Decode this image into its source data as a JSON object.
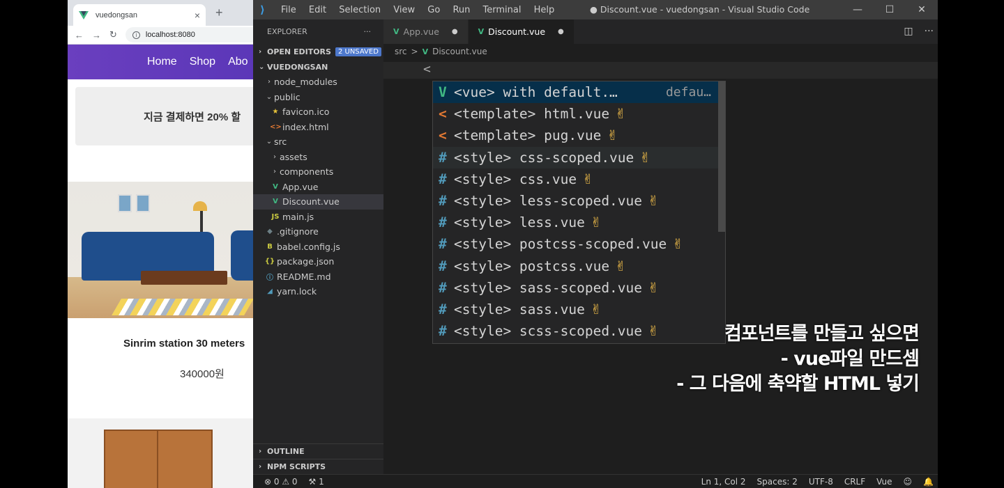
{
  "browser": {
    "tab_title": "vuedongsan",
    "tab_close": "×",
    "new_tab": "+",
    "address": "localhost:8080",
    "nav": [
      "Home",
      "Shop",
      "Abo"
    ],
    "banner_text": "지금 결제하면 20% 할",
    "product1_title": "Sinrim station 30 meters",
    "product1_price": "340000원",
    "colors": {
      "nav_bg": "#5b37b8"
    }
  },
  "vscode": {
    "logo": "vscode-logo-icon",
    "menu": [
      "File",
      "Edit",
      "Selection",
      "View",
      "Go",
      "Run",
      "Terminal",
      "Help"
    ],
    "window_title": "● Discount.vue - vuedongsan - Visual Studio Code",
    "window_controls": [
      "—",
      "☐",
      "✕"
    ],
    "explorer_title": "EXPLORER",
    "explorer_more": "···",
    "open_editors_label": "OPEN EDITORS",
    "open_editors_badge": "2 UNSAVED",
    "project_label": "VUEDONGSAN",
    "tree": [
      {
        "label": "node_modules",
        "indent": 1,
        "chev": "›",
        "icon": ""
      },
      {
        "label": "public",
        "indent": 1,
        "chev": "⌄",
        "icon": ""
      },
      {
        "label": "favicon.ico",
        "indent": 2,
        "chev": "",
        "icon": "★"
      },
      {
        "label": "index.html",
        "indent": 2,
        "chev": "",
        "icon": "<>"
      },
      {
        "label": "src",
        "indent": 1,
        "chev": "⌄",
        "icon": ""
      },
      {
        "label": "assets",
        "indent": 2,
        "chev": "›",
        "icon": ""
      },
      {
        "label": "components",
        "indent": 2,
        "chev": "›",
        "icon": ""
      },
      {
        "label": "App.vue",
        "indent": 2,
        "chev": "",
        "icon": "V"
      },
      {
        "label": "Discount.vue",
        "indent": 2,
        "chev": "",
        "icon": "V",
        "selected": true
      },
      {
        "label": "main.js",
        "indent": 2,
        "chev": "",
        "icon": "JS"
      },
      {
        "label": ".gitignore",
        "indent": 1,
        "chev": "",
        "icon": "◆"
      },
      {
        "label": "babel.config.js",
        "indent": 1,
        "chev": "",
        "icon": "B"
      },
      {
        "label": "package.json",
        "indent": 1,
        "chev": "",
        "icon": "{}"
      },
      {
        "label": "README.md",
        "indent": 1,
        "chev": "",
        "icon": "ⓘ"
      },
      {
        "label": "yarn.lock",
        "indent": 1,
        "chev": "",
        "icon": "◢"
      }
    ],
    "outline_label": "OUTLINE",
    "npm_label": "NPM SCRIPTS",
    "tabs": [
      {
        "label": "App.vue",
        "active": false,
        "dot": "●"
      },
      {
        "label": "Discount.vue",
        "active": true,
        "dot": "●"
      }
    ],
    "breadcrumb": {
      "folder": "src",
      "sep": ">",
      "file": "Discount.vue"
    },
    "code_line": "<",
    "suggestions": [
      {
        "icon": "V",
        "kind": "v",
        "label": "<vue> with default.…",
        "detail": "defau…"
      },
      {
        "icon": "<",
        "kind": "t",
        "label": "<template> html.vue",
        "hand": "✌"
      },
      {
        "icon": "<",
        "kind": "t",
        "label": "<template> pug.vue",
        "hand": "✌"
      },
      {
        "icon": "#",
        "kind": "s",
        "label": "<style> css-scoped.vue",
        "hand": "✌",
        "hover": true
      },
      {
        "icon": "#",
        "kind": "s",
        "label": "<style> css.vue",
        "hand": "✌"
      },
      {
        "icon": "#",
        "kind": "s",
        "label": "<style> less-scoped.vue",
        "hand": "✌"
      },
      {
        "icon": "#",
        "kind": "s",
        "label": "<style> less.vue",
        "hand": "✌"
      },
      {
        "icon": "#",
        "kind": "s",
        "label": "<style> postcss-scoped.vue",
        "hand": "✌"
      },
      {
        "icon": "#",
        "kind": "s",
        "label": "<style> postcss.vue",
        "hand": "✌"
      },
      {
        "icon": "#",
        "kind": "s",
        "label": "<style> sass-scoped.vue",
        "hand": "✌"
      },
      {
        "icon": "#",
        "kind": "s",
        "label": "<style> sass.vue",
        "hand": "✌"
      },
      {
        "icon": "#",
        "kind": "s",
        "label": "<style> scss-scoped.vue",
        "hand": "✌"
      }
    ],
    "caption": [
      "컴포넌트를 만들고 싶으면",
      "- vue파일 만드셈",
      "- 그 다음에 축약할 HTML 넣기"
    ],
    "status": {
      "errors": "⊗ 0 ⚠ 0",
      "ports": "⚒ 1",
      "position": "Ln 1, Col 2",
      "spaces": "Spaces: 2",
      "encoding": "UTF-8",
      "eol": "CRLF",
      "language": "Vue",
      "feedback": "☺",
      "bell": "🔔"
    },
    "colors": {
      "vue_green": "#41b883",
      "badge": "#4d78cc"
    }
  }
}
